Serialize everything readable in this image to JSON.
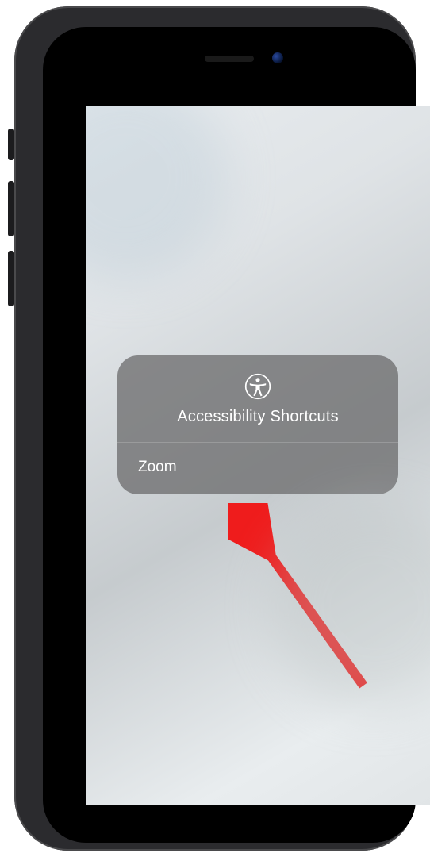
{
  "popup": {
    "title": "Accessibility Shortcuts",
    "items": [
      {
        "label": "Zoom"
      }
    ]
  }
}
